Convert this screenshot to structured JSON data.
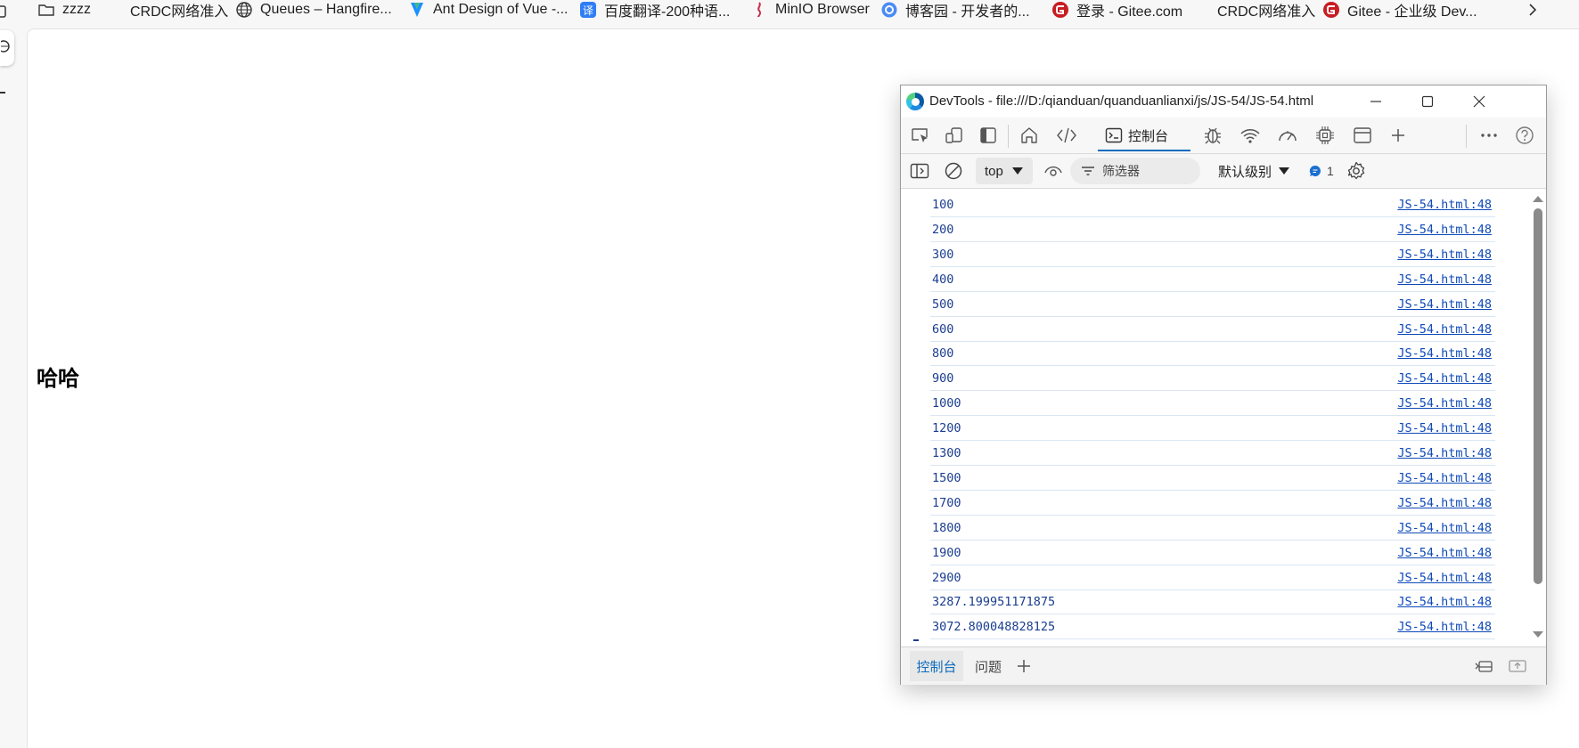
{
  "bookmarks": {
    "items": [
      {
        "label": "zzzz",
        "icon": "folder-icon"
      },
      {
        "label": "CRDC网络准入",
        "icon": "blank-icon"
      },
      {
        "label": "Queues – Hangfire...",
        "icon": "globe-icon"
      },
      {
        "label": "Ant Design of Vue -...",
        "icon": "antdv-logo-icon"
      },
      {
        "label": "百度翻译-200种语...",
        "icon": "baidu-translate-icon"
      },
      {
        "label": "MinIO Browser",
        "icon": "minio-logo-icon"
      },
      {
        "label": "博客园 - 开发者的...",
        "icon": "cnblogs-logo-icon"
      },
      {
        "label": "登录 - Gitee.com",
        "icon": "gitee-logo-icon"
      },
      {
        "label": "CRDC网络准入",
        "icon": "blank-icon"
      },
      {
        "label": "Gitee - 企业级 Dev...",
        "icon": "gitee-logo-icon"
      }
    ]
  },
  "page": {
    "heading": "哈哈"
  },
  "devtools": {
    "title": "DevTools - file:///D:/qianduan/quanduanlianxi/js/JS-54/JS-54.html",
    "toolbar": {
      "console_tab_label": "控制台"
    },
    "filterbar": {
      "context": "top",
      "filter_placeholder": "筛选器",
      "level": "默认级别",
      "issues_count": "1"
    },
    "console": {
      "source": "JS-54.html:48",
      "messages": [
        "100",
        "200",
        "300",
        "400",
        "500",
        "600",
        "800",
        "900",
        "1000",
        "1200",
        "1300",
        "1500",
        "1700",
        "1800",
        "1900",
        "2900",
        "3287.199951171875",
        "3072.800048828125"
      ]
    },
    "drawer": {
      "tabs": [
        "控制台",
        "问题"
      ]
    }
  },
  "colors": {
    "accent": "#0f6cbd",
    "log_value": "#1a3d8f",
    "link": "#0f4ab8"
  }
}
